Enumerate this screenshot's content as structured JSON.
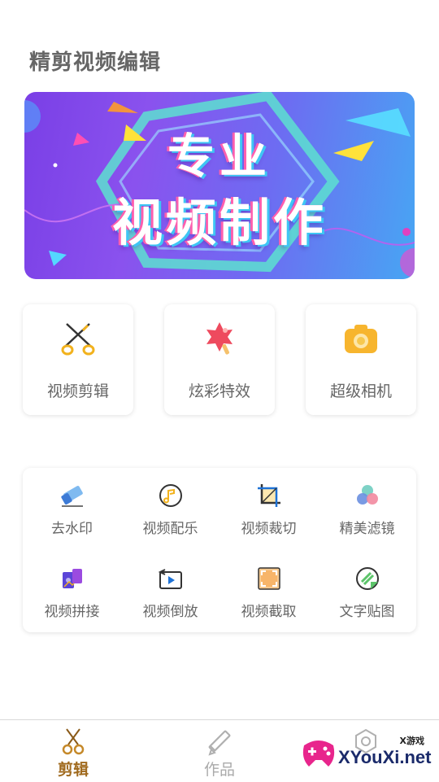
{
  "header": {
    "title": "精剪视频编辑"
  },
  "banner": {
    "line1": "专业",
    "line2": "视频制作"
  },
  "main_cards": [
    {
      "label": "视频剪辑",
      "icon": "scissors-icon"
    },
    {
      "label": "炫彩特效",
      "icon": "popsicle-icon"
    },
    {
      "label": "超级相机",
      "icon": "camera-icon"
    }
  ],
  "tools": [
    {
      "label": "去水印",
      "icon": "eraser-icon"
    },
    {
      "label": "视频配乐",
      "icon": "music-note-icon"
    },
    {
      "label": "视频裁切",
      "icon": "crop-icon"
    },
    {
      "label": "精美滤镜",
      "icon": "filter-circles-icon"
    },
    {
      "label": "视频拼接",
      "icon": "puzzle-icon"
    },
    {
      "label": "视频倒放",
      "icon": "reverse-play-icon"
    },
    {
      "label": "视频截取",
      "icon": "capture-frame-icon"
    },
    {
      "label": "文字贴图",
      "icon": "sticker-icon"
    }
  ],
  "bottom_nav": [
    {
      "label": "剪辑",
      "icon": "scissors-icon",
      "active": true
    },
    {
      "label": "作品",
      "icon": "pencil-ruler-icon",
      "active": false
    },
    {
      "label": "",
      "icon": "settings-icon",
      "active": false
    }
  ],
  "watermark": {
    "small": "X游戏",
    "text": "XYouXi.net"
  },
  "colors": {
    "accent": "#a06a1e",
    "banner_start": "#7a3fe6",
    "banner_end": "#47a6f3",
    "camera": "#f7b52e",
    "popsicle": "#ee4a5e"
  }
}
